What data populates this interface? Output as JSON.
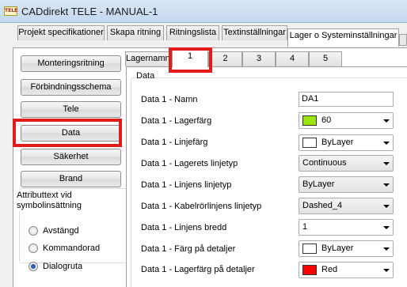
{
  "window": {
    "icon_text": "TELE",
    "title": "CADdirekt TELE - MANUAL-1"
  },
  "main_tabs": [
    {
      "label": "Projekt specifikationer"
    },
    {
      "label": "Skapa ritning"
    },
    {
      "label": "Ritningslista"
    },
    {
      "label": "Textinställningar"
    },
    {
      "label": "Lager o Systeminställningar"
    }
  ],
  "left_buttons": [
    {
      "label": "Monteringsritning"
    },
    {
      "label": "Förbindningsschema"
    },
    {
      "label": "Tele"
    },
    {
      "label": "Data"
    },
    {
      "label": "Säkerhet"
    },
    {
      "label": "Brand"
    }
  ],
  "attribute_group": {
    "title": "Attributtext vid symbolinsättning",
    "options": [
      {
        "label": "Avstängd",
        "checked": false
      },
      {
        "label": "Kommandorad",
        "checked": false
      },
      {
        "label": "Dialogruta",
        "checked": true
      }
    ]
  },
  "inner_tabs": [
    {
      "label": "Lagernamn"
    },
    {
      "label": "1"
    },
    {
      "label": "2"
    },
    {
      "label": "3"
    },
    {
      "label": "4"
    },
    {
      "label": "5"
    }
  ],
  "data_group": {
    "title": "Data",
    "rows": [
      {
        "label": "Data 1 - Namn",
        "value": "DA1"
      },
      {
        "label": "Data 1 - Lagerfärg",
        "value": "60",
        "swatch": "#99e600"
      },
      {
        "label": "Data 1 - Linjefärg",
        "value": "ByLayer",
        "swatch": "#ffffff"
      },
      {
        "label": "Data 1 - Lagerets linjetyp",
        "value": "Continuous"
      },
      {
        "label": "Data 1 - Linjens linjetyp",
        "value": "ByLayer"
      },
      {
        "label": "Data 1 - Kabelrörlinjens linjetyp",
        "value": "Dashed_4"
      },
      {
        "label": "Data 1 - Linjens bredd",
        "value": "1"
      },
      {
        "label": "Data 1 - Färg på detaljer",
        "value": "ByLayer",
        "swatch": "#ffffff"
      },
      {
        "label": "Data 1 - Lagerfärg på detaljer",
        "value": "Red",
        "swatch": "#ff0000"
      }
    ]
  },
  "colors": {
    "highlight": "#e21b1b",
    "title_bar": "#c3d7ef",
    "accent_radio": "#2a5fb0"
  }
}
